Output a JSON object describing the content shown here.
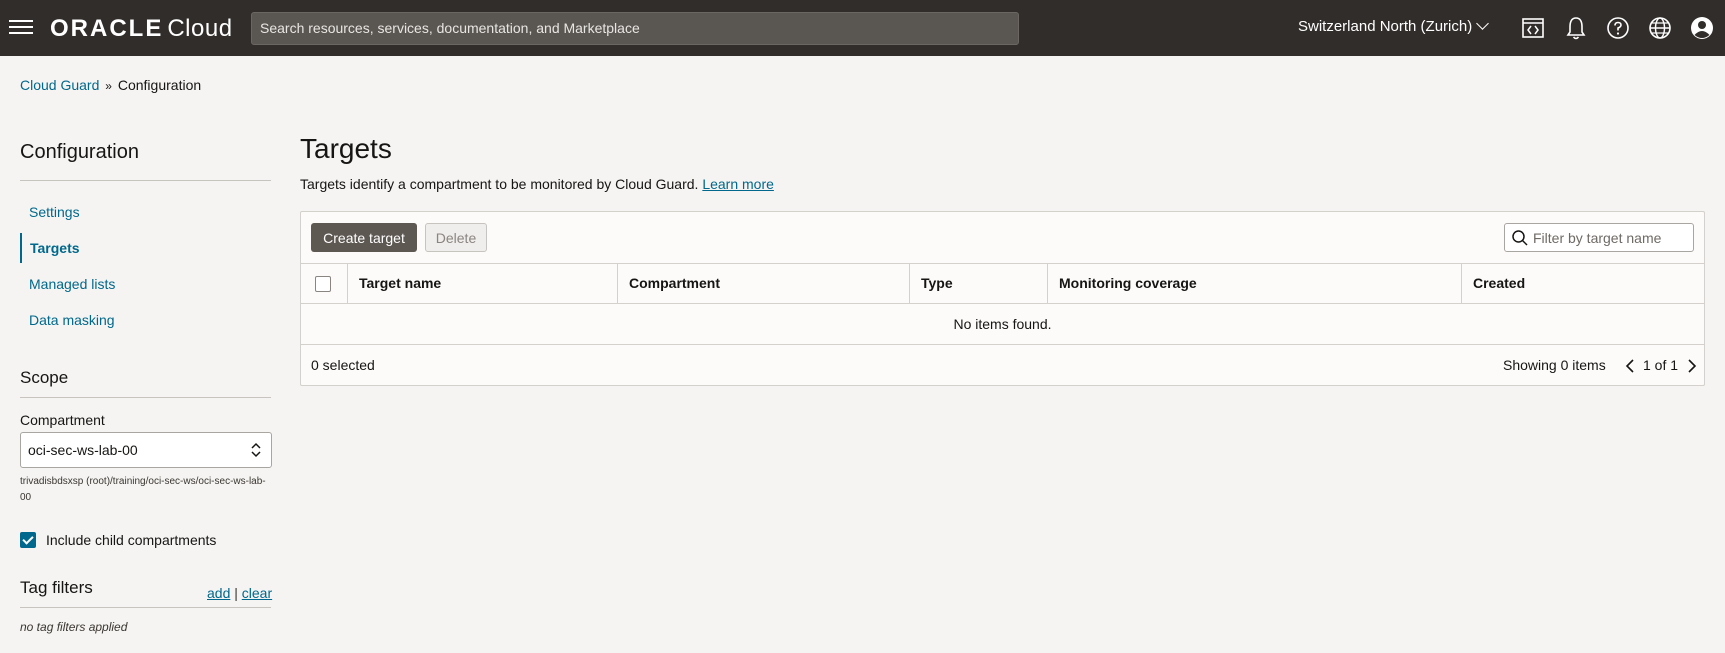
{
  "header": {
    "brand_oracle": "ORACLE",
    "brand_cloud": "Cloud",
    "search_placeholder": "Search resources, services, documentation, and Marketplace",
    "region": "Switzerland North (Zurich)",
    "icons": [
      "code-editor-icon",
      "bell-icon",
      "help-icon",
      "globe-icon",
      "user-icon"
    ]
  },
  "breadcrumb": {
    "parent": "Cloud Guard",
    "separator": "»",
    "current": "Configuration"
  },
  "sidebar": {
    "title": "Configuration",
    "items": [
      {
        "label": "Settings",
        "active": false
      },
      {
        "label": "Targets",
        "active": true
      },
      {
        "label": "Managed lists",
        "active": false
      },
      {
        "label": "Data masking",
        "active": false
      }
    ],
    "scope": {
      "title": "Scope",
      "compartment_label": "Compartment",
      "compartment_value": "oci-sec-ws-lab-00",
      "compartment_path": "trivadisbdsxsp (root)/training/oci-sec-ws/oci-sec-ws-lab-00",
      "include_child_label": "Include child compartments",
      "include_child_checked": true
    },
    "tag_filters": {
      "title": "Tag filters",
      "add_label": "add",
      "divider": "|",
      "clear_label": "clear",
      "empty_text": "no tag filters applied"
    }
  },
  "main": {
    "title": "Targets",
    "description": "Targets identify a compartment to be monitored by Cloud Guard.",
    "learn_more": "Learn more",
    "toolbar": {
      "create_label": "Create target",
      "delete_label": "Delete",
      "filter_placeholder": "Filter by target name"
    },
    "table": {
      "columns": [
        "Target name",
        "Compartment",
        "Type",
        "Monitoring coverage",
        "Created"
      ],
      "empty_message": "No items found.",
      "selected_text": "0 selected",
      "showing_text": "Showing 0 items",
      "page_info": "1 of 1"
    }
  },
  "colors": {
    "topbar": "#312d2a",
    "link": "#00688c",
    "primary_button": "#5e5853",
    "background": "#f5f4f2"
  }
}
